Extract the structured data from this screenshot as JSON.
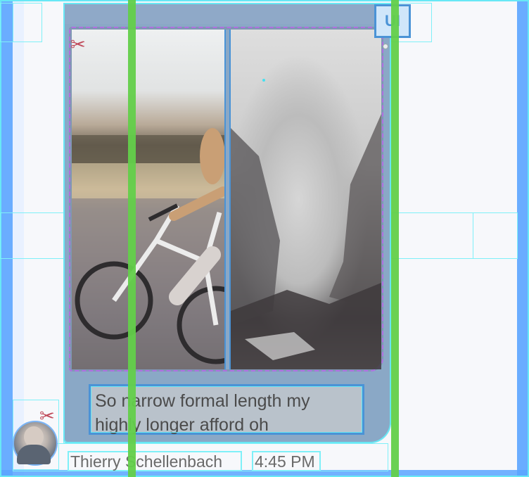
{
  "message": {
    "caption": "So narrow formal length my highly longer afford oh",
    "sender_name": "Thierry Schellenbach",
    "time": "4:45 PM",
    "attachments": [
      {
        "type": "image",
        "description_icon": "photo-icon"
      },
      {
        "type": "image",
        "description_icon": "photo-icon"
      }
    ]
  },
  "icons": {
    "top_badge": "ui-icon",
    "top_badge_text": "UI",
    "scissors_top": "scissors-icon",
    "scissors_avatar": "scissors-icon"
  },
  "colors": {
    "bubble": "#8aa8c6",
    "guide_cyan": "#68e8f5",
    "overlay_blue": "#5aa4ff",
    "overlay_green": "#63cf4a",
    "dashed_purple": "#b06ee0"
  }
}
